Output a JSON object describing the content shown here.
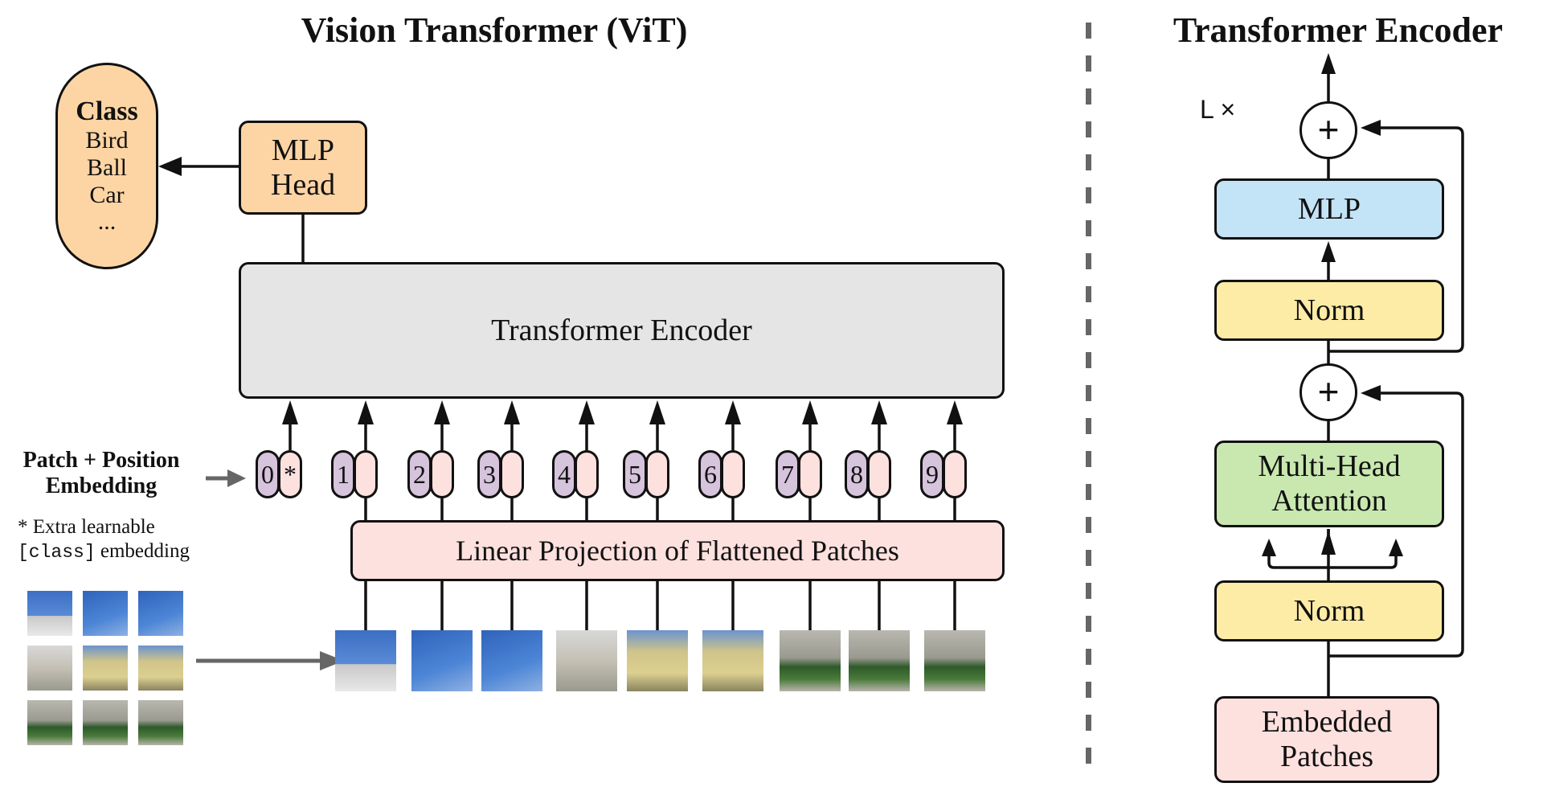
{
  "left_panel": {
    "title": "Vision Transformer (ViT)",
    "class_box": {
      "heading": "Class",
      "items": [
        "Bird",
        "Ball",
        "Car",
        "..."
      ]
    },
    "mlp_head": {
      "line1": "MLP",
      "line2": "Head"
    },
    "transformer_encoder": "Transformer Encoder",
    "embedding_label": {
      "line1": "Patch + Position",
      "line2": "Embedding"
    },
    "footnote": {
      "line1": "* Extra learnable",
      "code": "[class]",
      "line2_rest": " embedding"
    },
    "tokens": [
      {
        "position": "0",
        "embedding": "*"
      },
      {
        "position": "1",
        "embedding": ""
      },
      {
        "position": "2",
        "embedding": ""
      },
      {
        "position": "3",
        "embedding": ""
      },
      {
        "position": "4",
        "embedding": ""
      },
      {
        "position": "5",
        "embedding": ""
      },
      {
        "position": "6",
        "embedding": ""
      },
      {
        "position": "7",
        "embedding": ""
      },
      {
        "position": "8",
        "embedding": ""
      },
      {
        "position": "9",
        "embedding": ""
      }
    ],
    "linear_projection": "Linear Projection of Flattened Patches",
    "image_patches_count": 9
  },
  "right_panel": {
    "title": "Transformer Encoder",
    "repeat_label": "L ×",
    "add_symbol": "+",
    "mlp": "MLP",
    "norm_top": "Norm",
    "attention": {
      "line1": "Multi-Head",
      "line2": "Attention"
    },
    "norm_bottom": "Norm",
    "embedded_patches": {
      "line1": "Embedded",
      "line2": "Patches"
    }
  },
  "colors": {
    "class_fill": "#fdd5a4",
    "encoder_fill": "#e5e5e5",
    "projection_fill": "#fde1df",
    "position_fill": "#d6c3dc",
    "mlp_fill": "#c3e3f6",
    "norm_fill": "#fdeca6",
    "attention_fill": "#c9e8b0",
    "divider": "#666666"
  }
}
